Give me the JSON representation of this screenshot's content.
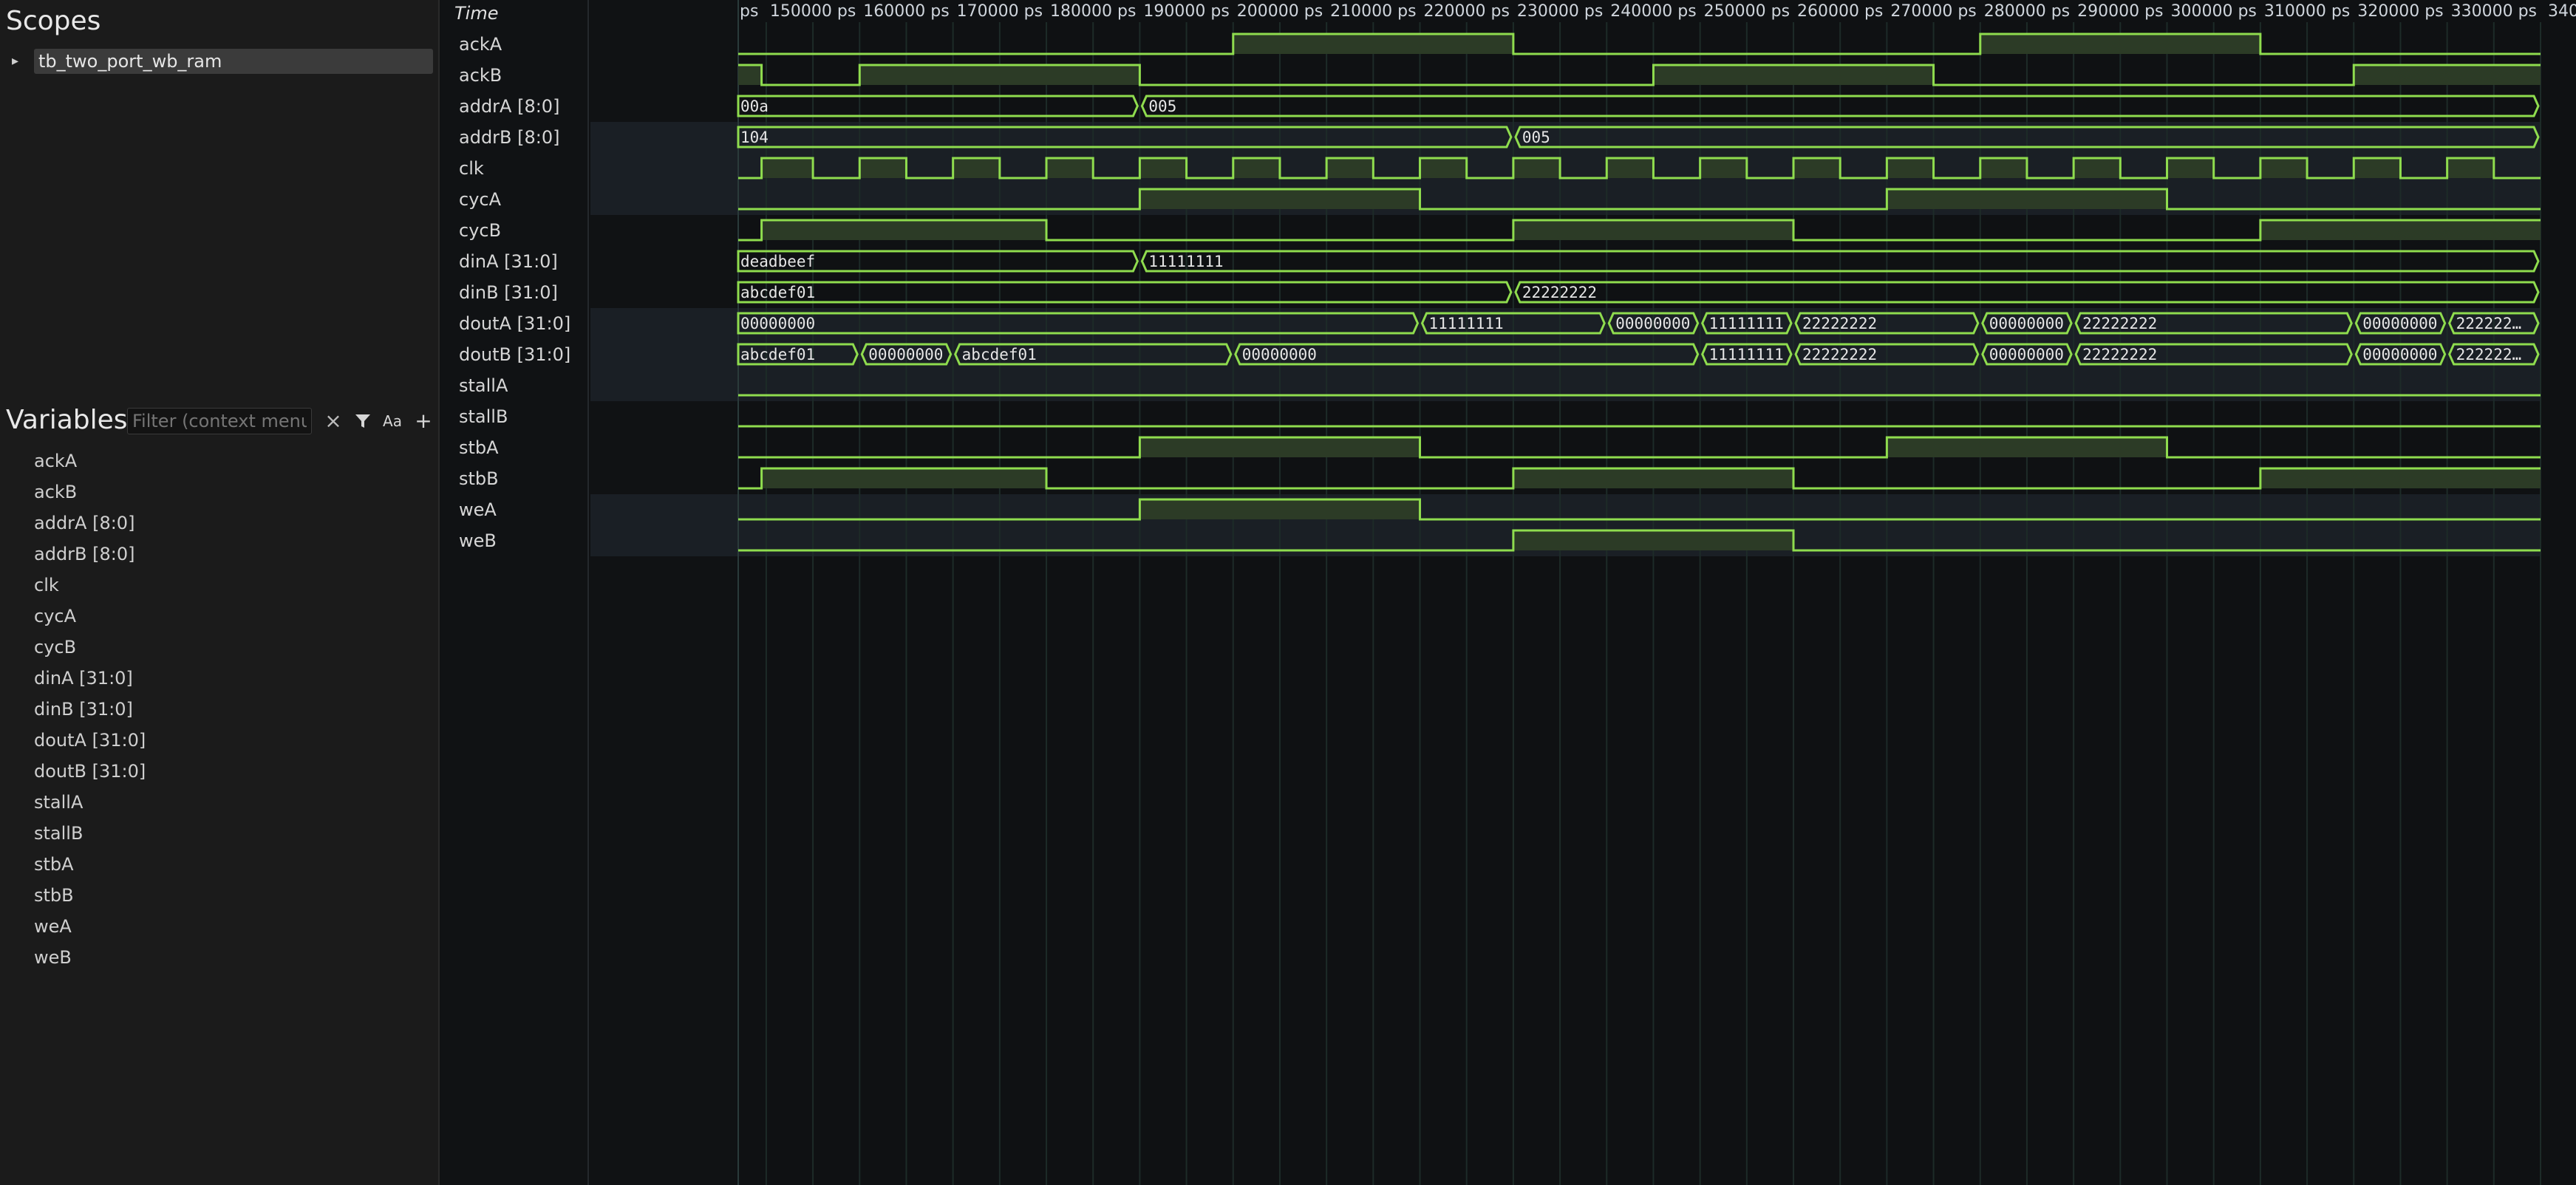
{
  "scopes": {
    "title": "Scopes",
    "expand_glyph": "▸",
    "items": [
      {
        "label": "tb_two_port_wb_ram"
      }
    ]
  },
  "variables": {
    "title": "Variables",
    "filter_placeholder": "Filter (context menu",
    "clear_icon": "×",
    "filter_icon": "filter-icon",
    "case_label": "Aa",
    "add_label": "+",
    "items": [
      "ackA",
      "ackB",
      "addrA [8:0]",
      "addrB [8:0]",
      "clk",
      "cycA",
      "cycB",
      "dinA [31:0]",
      "dinB [31:0]",
      "doutA [31:0]",
      "doutB [31:0]",
      "stallA",
      "stallB",
      "stbA",
      "stbB",
      "weA",
      "weB"
    ]
  },
  "waveform": {
    "time_label": "Time",
    "tick_labels": [
      "ps",
      "150000 ps",
      "160000 ps",
      "170000 ps",
      "180000 ps",
      "190000 ps",
      "200000 ps",
      "210000 ps",
      "220000 ps",
      "230000 ps",
      "240000 ps",
      "250000 ps",
      "260000 ps",
      "270000 ps",
      "280000 ps",
      "290000 ps",
      "300000 ps",
      "310000 ps",
      "320000 ps",
      "330000 ps",
      "340"
    ],
    "signal_names": [
      "ackA",
      "ackB",
      "addrA [8:0]",
      "addrB [8:0]",
      "clk",
      "cycA",
      "cycB",
      "dinA [31:0]",
      "dinB [31:0]",
      "doutA [31:0]",
      "doutB [31:0]",
      "stallA",
      "stallB",
      "stbA",
      "stbB",
      "weA",
      "weB"
    ],
    "colors": {
      "trace": "#8fdc4e",
      "fill": "#2c3b26",
      "grid": "#1d2b28",
      "row_alt": "#1a1f25",
      "bg": "#0f1113"
    },
    "view_range_ps": [
      142000,
      335000
    ],
    "signals": {
      "ackA": {
        "kind": "bit",
        "init": 0,
        "transitions": [
          [
            195000,
            1
          ],
          [
            225000,
            0
          ],
          [
            275000,
            1
          ],
          [
            305000,
            0
          ]
        ]
      },
      "ackB": {
        "kind": "bit",
        "init": 1,
        "transitions": [
          [
            144500,
            0
          ],
          [
            155000,
            1
          ],
          [
            185000,
            0
          ],
          [
            240000,
            1
          ],
          [
            270000,
            0
          ],
          [
            315000,
            1
          ]
        ]
      },
      "clk": {
        "kind": "bit",
        "init": 0,
        "transitions": [
          [
            144500,
            1
          ],
          [
            150000,
            0
          ],
          [
            155000,
            1
          ],
          [
            160000,
            0
          ],
          [
            165000,
            1
          ],
          [
            170000,
            0
          ],
          [
            175000,
            1
          ],
          [
            180000,
            0
          ],
          [
            185000,
            1
          ],
          [
            190000,
            0
          ],
          [
            195000,
            1
          ],
          [
            200000,
            0
          ],
          [
            205000,
            1
          ],
          [
            210000,
            0
          ],
          [
            215000,
            1
          ],
          [
            220000,
            0
          ],
          [
            225000,
            1
          ],
          [
            230000,
            0
          ],
          [
            235000,
            1
          ],
          [
            240000,
            0
          ],
          [
            245000,
            1
          ],
          [
            250000,
            0
          ],
          [
            255000,
            1
          ],
          [
            260000,
            0
          ],
          [
            265000,
            1
          ],
          [
            270000,
            0
          ],
          [
            275000,
            1
          ],
          [
            280000,
            0
          ],
          [
            285000,
            1
          ],
          [
            290000,
            0
          ],
          [
            295000,
            1
          ],
          [
            300000,
            0
          ],
          [
            305000,
            1
          ],
          [
            310000,
            0
          ],
          [
            315000,
            1
          ],
          [
            320000,
            0
          ],
          [
            325000,
            1
          ],
          [
            330000,
            0
          ]
        ]
      },
      "cycA": {
        "kind": "bit",
        "init": 0,
        "transitions": [
          [
            185000,
            1
          ],
          [
            215000,
            0
          ],
          [
            265000,
            1
          ],
          [
            295000,
            0
          ]
        ]
      },
      "cycB": {
        "kind": "bit",
        "init": 0,
        "transitions": [
          [
            144500,
            1
          ],
          [
            175000,
            0
          ],
          [
            225000,
            1
          ],
          [
            255000,
            0
          ],
          [
            305000,
            1
          ]
        ]
      },
      "stallA": {
        "kind": "bit",
        "init": 0,
        "transitions": []
      },
      "stallB": {
        "kind": "bit",
        "init": 0,
        "transitions": []
      },
      "stbA": {
        "kind": "bit",
        "init": 0,
        "transitions": [
          [
            185000,
            1
          ],
          [
            215000,
            0
          ],
          [
            265000,
            1
          ],
          [
            295000,
            0
          ]
        ]
      },
      "stbB": {
        "kind": "bit",
        "init": 0,
        "transitions": [
          [
            144500,
            1
          ],
          [
            175000,
            0
          ],
          [
            225000,
            1
          ],
          [
            255000,
            0
          ],
          [
            305000,
            1
          ]
        ]
      },
      "weA": {
        "kind": "bit",
        "init": 0,
        "transitions": [
          [
            185000,
            1
          ],
          [
            215000,
            0
          ]
        ]
      },
      "weB": {
        "kind": "bit",
        "init": 0,
        "transitions": [
          [
            225000,
            1
          ],
          [
            255000,
            0
          ]
        ]
      },
      "addrA [8:0]": {
        "kind": "bus",
        "segments": [
          [
            142000,
            "00a"
          ],
          [
            185000,
            "005"
          ]
        ]
      },
      "addrB [8:0]": {
        "kind": "bus",
        "segments": [
          [
            142000,
            "104"
          ],
          [
            225000,
            "005"
          ]
        ]
      },
      "dinA [31:0]": {
        "kind": "bus",
        "segments": [
          [
            142000,
            "deadbeef"
          ],
          [
            185000,
            "11111111"
          ]
        ]
      },
      "dinB [31:0]": {
        "kind": "bus",
        "segments": [
          [
            142000,
            "abcdef01"
          ],
          [
            225000,
            "22222222"
          ]
        ]
      },
      "doutA [31:0]": {
        "kind": "bus",
        "segments": [
          [
            142000,
            "00000000"
          ],
          [
            215000,
            "11111111"
          ],
          [
            235000,
            "00000000"
          ],
          [
            245000,
            "11111111"
          ],
          [
            255000,
            "22222222"
          ],
          [
            275000,
            "00000000"
          ],
          [
            285000,
            "22222222"
          ],
          [
            315000,
            "00000000"
          ],
          [
            325000,
            "222222…"
          ]
        ]
      },
      "doutB [31:0]": {
        "kind": "bus",
        "segments": [
          [
            142000,
            "abcdef01"
          ],
          [
            155000,
            "00000000"
          ],
          [
            165000,
            "abcdef01"
          ],
          [
            195000,
            "00000000"
          ],
          [
            245000,
            "11111111"
          ],
          [
            255000,
            "22222222"
          ],
          [
            275000,
            "00000000"
          ],
          [
            285000,
            "22222222"
          ],
          [
            315000,
            "00000000"
          ],
          [
            325000,
            "222222…"
          ]
        ]
      }
    }
  }
}
